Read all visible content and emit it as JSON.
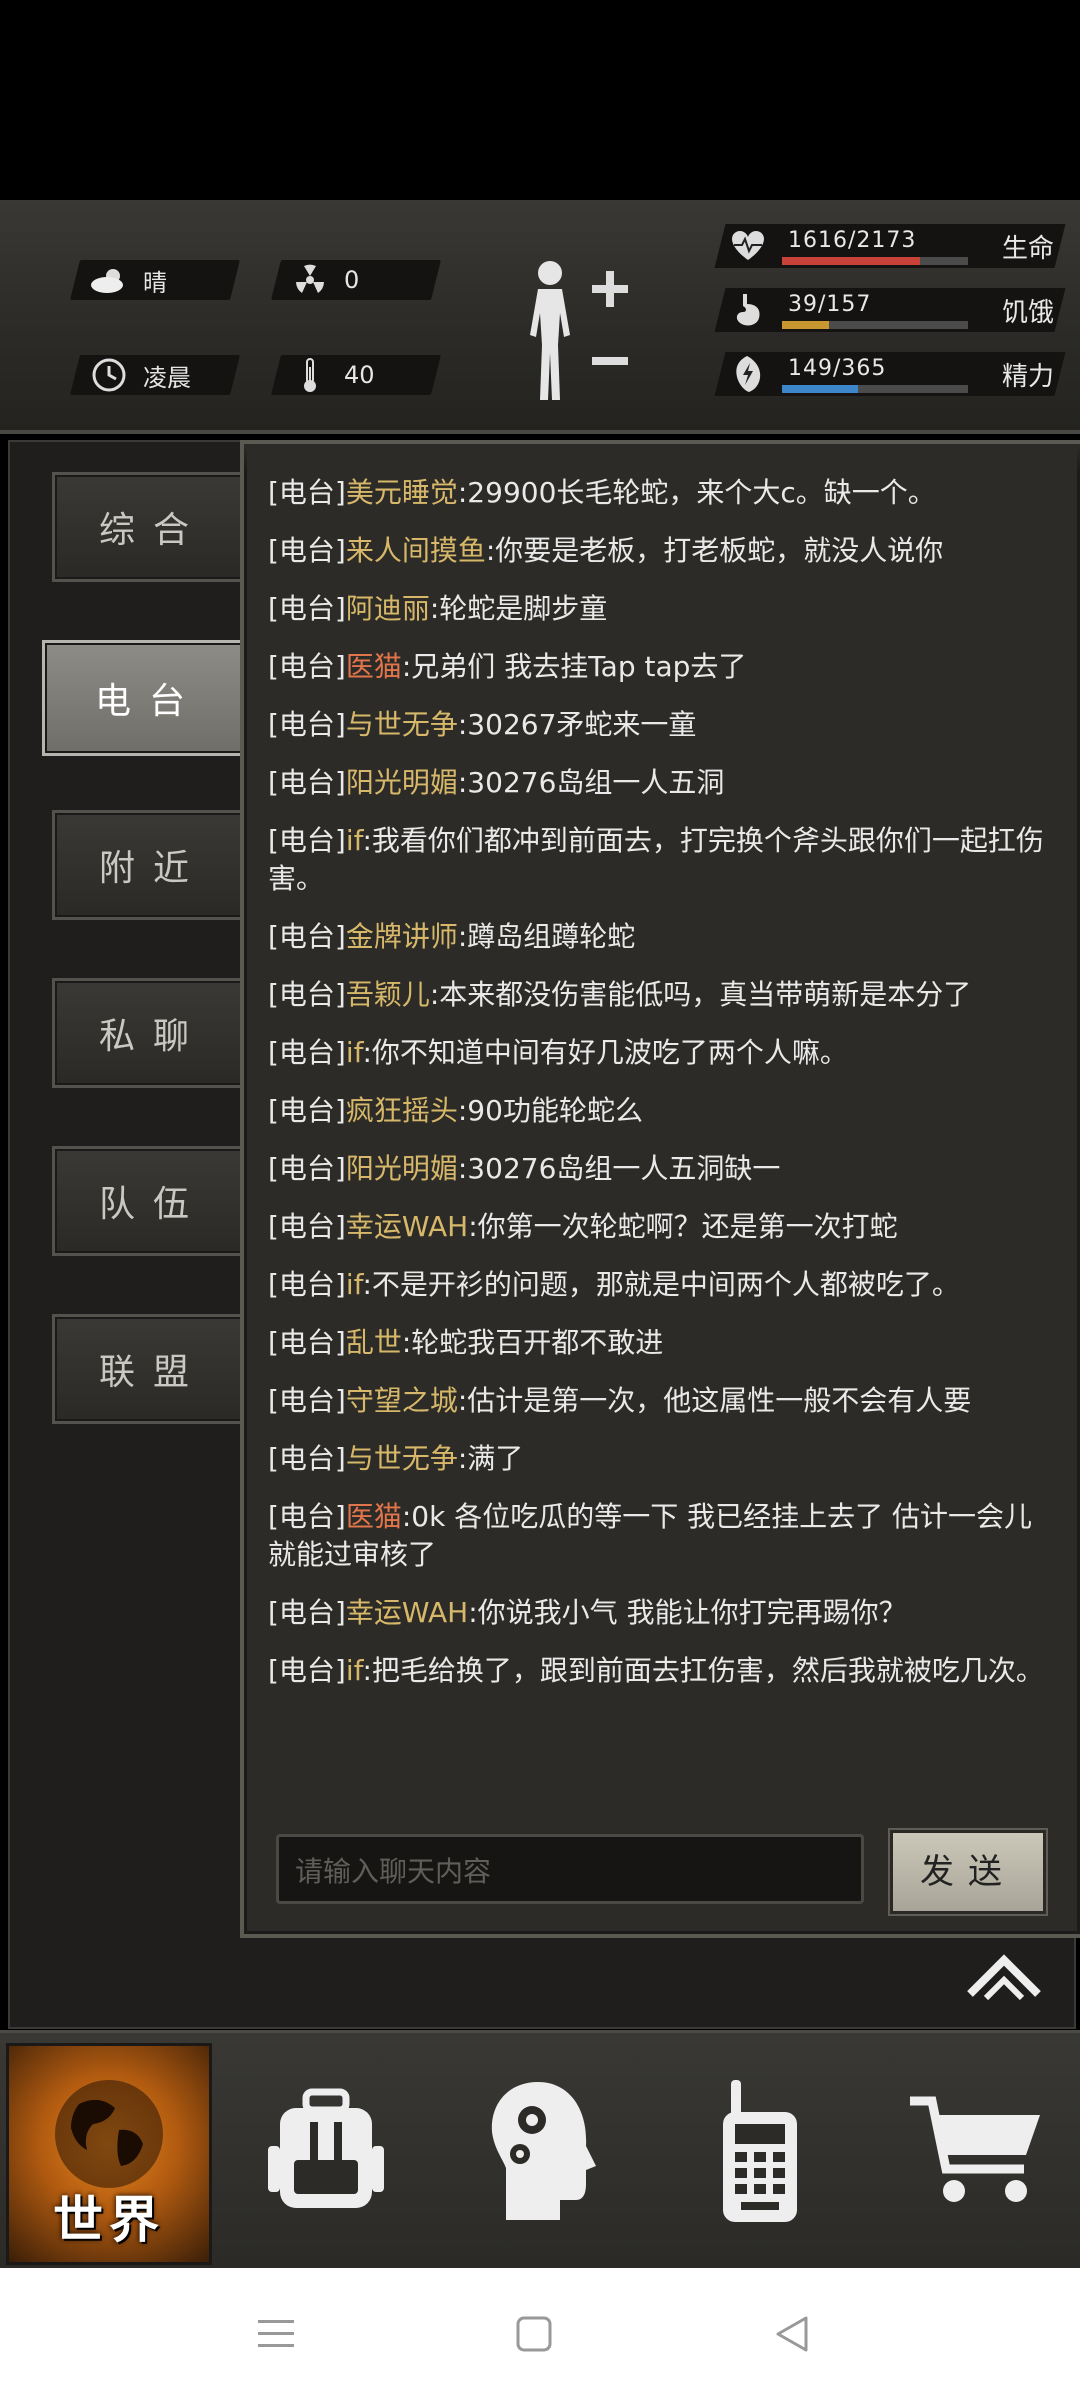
{
  "hud": {
    "weather": "晴",
    "radiation": "0",
    "time_of_day": "凌晨",
    "temperature": "40",
    "stats": [
      {
        "icon": "heart-pulse-icon",
        "value": "1616/2173",
        "name": "生命",
        "fill": 0.74,
        "color": "#c9423a"
      },
      {
        "icon": "stomach-icon",
        "value": "39/157",
        "name": "饥饿",
        "fill": 0.25,
        "color": "#c9972f"
      },
      {
        "icon": "energy-icon",
        "value": "149/365",
        "name": "精力",
        "fill": 0.41,
        "color": "#3d86c9"
      }
    ]
  },
  "tabs": [
    "综合",
    "电台",
    "附近",
    "私聊",
    "队伍",
    "联盟"
  ],
  "active_tab": "电台",
  "messages": [
    {
      "channel": "[电台]",
      "user": "美元睡觉",
      "text": ":29900长毛轮蛇，来个大c。缺一个。",
      "red": false
    },
    {
      "channel": "[电台]",
      "user": "来人间摸鱼",
      "text": ":你要是老板，打老板蛇，就没人说你",
      "red": false
    },
    {
      "channel": "[电台]",
      "user": "阿迪丽",
      "text": ":轮蛇是脚步童",
      "red": false
    },
    {
      "channel": "[电台]",
      "user": "医猫",
      "text": ":兄弟们 我去挂Tap tap去了",
      "red": true
    },
    {
      "channel": "[电台]",
      "user": "与世无争",
      "text": ":30267矛蛇来一童",
      "red": false
    },
    {
      "channel": "[电台]",
      "user": "阳光明媚",
      "text": ":30276岛组一人五洞",
      "red": false
    },
    {
      "channel": "[电台]",
      "user": "if",
      "text": ":我看你们都冲到前面去，打完换个斧头跟你们一起扛伤害。",
      "red": false
    },
    {
      "channel": "[电台]",
      "user": "金牌讲师",
      "text": ":蹲岛组蹲轮蛇",
      "red": false
    },
    {
      "channel": "[电台]",
      "user": "吾颖儿",
      "text": ":本来都没伤害能低吗，真当带萌新是本分了",
      "red": false
    },
    {
      "channel": "[电台]",
      "user": "if",
      "text": ":你不知道中间有好几波吃了两个人嘛。",
      "red": false
    },
    {
      "channel": "[电台]",
      "user": "疯狂摇头",
      "text": ":90功能轮蛇么",
      "red": false
    },
    {
      "channel": "[电台]",
      "user": "阳光明媚",
      "text": ":30276岛组一人五洞缺一",
      "red": false
    },
    {
      "channel": "[电台]",
      "user": "幸运WAH",
      "text": ":你第一次轮蛇啊？还是第一次打蛇",
      "red": false
    },
    {
      "channel": "[电台]",
      "user": "if",
      "text": ":不是开衫的问题，那就是中间两个人都被吃了。",
      "red": false
    },
    {
      "channel": "[电台]",
      "user": "乱世",
      "text": ":轮蛇我百开都不敢进",
      "red": false
    },
    {
      "channel": "[电台]",
      "user": "守望之城",
      "text": ":估计是第一次，他这属性一般不会有人要",
      "red": false
    },
    {
      "channel": "[电台]",
      "user": "与世无争",
      "text": ":满了",
      "red": false
    },
    {
      "channel": "[电台]",
      "user": "医猫",
      "text": ":0k 各位吃瓜的等一下 我已经挂上去了 估计一会儿就能过审核了",
      "red": true
    },
    {
      "channel": "[电台]",
      "user": "幸运WAH",
      "text": ":你说我小气 我能让你打完再踢你？",
      "red": false
    },
    {
      "channel": "[电台]",
      "user": "if",
      "text": ":把毛给换了，跟到前面去扛伤害，然后我就被吃几次。",
      "red": false
    }
  ],
  "input": {
    "placeholder": "请输入聊天内容"
  },
  "send_label": "发送",
  "nav": {
    "world_label": "世界"
  }
}
